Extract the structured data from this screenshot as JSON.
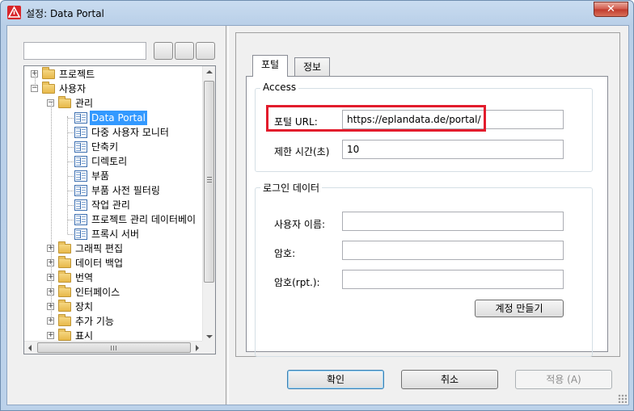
{
  "window": {
    "title": "설정: Data Portal",
    "close_symbol": "✕"
  },
  "left": {
    "search": {
      "value": "",
      "placeholder": ""
    },
    "tree": [
      {
        "label": "프로젝트",
        "level": 0,
        "kind": "folder",
        "expander": "+"
      },
      {
        "label": "사용자",
        "level": 0,
        "kind": "folder",
        "expander": "−"
      },
      {
        "label": "관리",
        "level": 1,
        "kind": "folder",
        "expander": "−"
      },
      {
        "label": "Data Portal",
        "level": 2,
        "kind": "page",
        "selected": true
      },
      {
        "label": "다중 사용자 모니터",
        "level": 2,
        "kind": "page"
      },
      {
        "label": "단축키",
        "level": 2,
        "kind": "page"
      },
      {
        "label": "디렉토리",
        "level": 2,
        "kind": "page"
      },
      {
        "label": "부품",
        "level": 2,
        "kind": "page"
      },
      {
        "label": "부품 사전 필터링",
        "level": 2,
        "kind": "page"
      },
      {
        "label": "작업 관리",
        "level": 2,
        "kind": "page"
      },
      {
        "label": "프로젝트 관리 데이터베이",
        "level": 2,
        "kind": "page"
      },
      {
        "label": "프록시 서버",
        "level": 2,
        "kind": "page"
      },
      {
        "label": "그래픽 편집",
        "level": 1,
        "kind": "folder",
        "expander": "+"
      },
      {
        "label": "데이터 백업",
        "level": 1,
        "kind": "folder",
        "expander": "+"
      },
      {
        "label": "번역",
        "level": 1,
        "kind": "folder",
        "expander": "+"
      },
      {
        "label": "인터페이스",
        "level": 1,
        "kind": "folder",
        "expander": "+"
      },
      {
        "label": "장치",
        "level": 1,
        "kind": "folder",
        "expander": "+"
      },
      {
        "label": "추가 기능",
        "level": 1,
        "kind": "folder",
        "expander": "+"
      },
      {
        "label": "표시",
        "level": 1,
        "kind": "folder",
        "expander": "+"
      }
    ]
  },
  "tabs": [
    {
      "label": "포털",
      "active": true
    },
    {
      "label": "정보",
      "active": false
    }
  ],
  "access": {
    "title": "Access",
    "portal_url_label": "포털 URL:",
    "portal_url_value": "https://eplandata.de/portal/",
    "timeout_label": "제한 시간(초)",
    "timeout_value": "10"
  },
  "login": {
    "title": "로그인 데이터",
    "username_label": "사용자 이름:",
    "username_value": "",
    "password_label": "암호:",
    "password_value": "",
    "password_repeat_label": "암호(rpt.):",
    "password_repeat_value": "",
    "create_account_label": "계정 만들기"
  },
  "footer": {
    "ok_label": "확인",
    "cancel_label": "취소",
    "apply_label": "적용 (A)"
  },
  "colors": {
    "selection": "#3399ff",
    "highlight_box": "#e21c2c",
    "title_icon": "#d8262a"
  }
}
